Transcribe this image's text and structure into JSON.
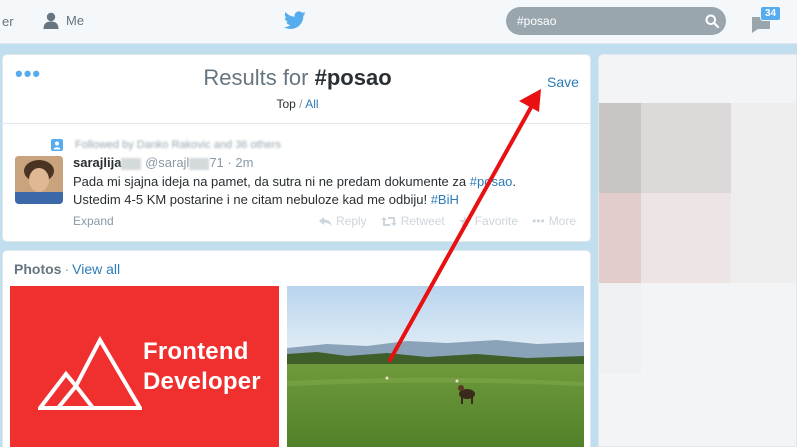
{
  "nav": {
    "partial_label": "er",
    "me_label": "Me",
    "search_value": "#posao",
    "notification_count": "34"
  },
  "results": {
    "title_prefix": "Results for",
    "query": "#posao",
    "save_label": "Save",
    "filter_top": "Top",
    "filter_sep": "/",
    "filter_all": "All"
  },
  "tweet": {
    "context": "Followed by Danko Rakovic and 36 others",
    "name": "sarajlija",
    "handle": "@sarajl",
    "handle_tail": "71",
    "separator": "·",
    "time": "2m",
    "text_line1_a": "Pada mi sjajna ideja na pamet, da sutra ni ne predam dokumente za ",
    "text_line1_hash": "#posao",
    "text_line1_b": ".",
    "text_line2_a": "Ustedim 4-5 KM postarine i ne citam nebuloze kad me odbiju! ",
    "text_line2_hash": "#BiH",
    "expand": "Expand",
    "reply": "Reply",
    "retweet": "Retweet",
    "favorite": "Favorite",
    "more": "More"
  },
  "photos": {
    "label": "Photos",
    "dot": "·",
    "view_all": "View all",
    "card_line1": "Frontend",
    "card_line2": "Developer"
  },
  "colors": {
    "accent": "#55acee",
    "link": "#2b7bb9",
    "background": "#c0deed",
    "photo_red": "#f0302f",
    "annotation_arrow": "#e81010"
  },
  "icons": [
    "person-icon",
    "twitter-bird-icon",
    "search-icon",
    "notifications-icon",
    "more-icon",
    "user-context-icon",
    "reply-icon",
    "retweet-icon",
    "favorite-icon",
    "more-dots-icon"
  ]
}
